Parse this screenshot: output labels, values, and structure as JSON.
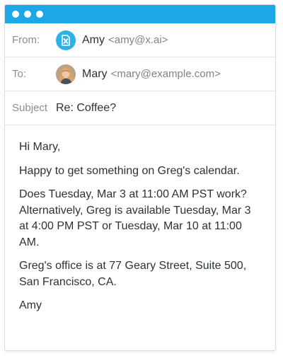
{
  "from": {
    "label": "From:",
    "name": "Amy",
    "email": "<amy@x.ai>",
    "avatar_icon": "x-ai-logo-icon"
  },
  "to": {
    "label": "To:",
    "name": "Mary",
    "email": "<mary@example.com>",
    "avatar_icon": "user-photo"
  },
  "subject": {
    "label": "Subject",
    "value": "Re: Coffee?"
  },
  "body": {
    "greeting": "Hi Mary,",
    "paragraphs": [
      "Happy to get something on Greg's calendar.",
      "Does Tuesday, Mar 3 at 11:00 AM PST work? Alternatively, Greg is available Tuesday, Mar 3 at 4:00 PM PST or Tuesday, Mar 10 at 11:00 AM.",
      "Greg's office is at 77 Geary Street, Suite 500, San Francisco, CA."
    ],
    "signature": "Amy"
  },
  "colors": {
    "titlebar": "#1ca8e6",
    "amy_avatar": "#2fb1e8"
  }
}
